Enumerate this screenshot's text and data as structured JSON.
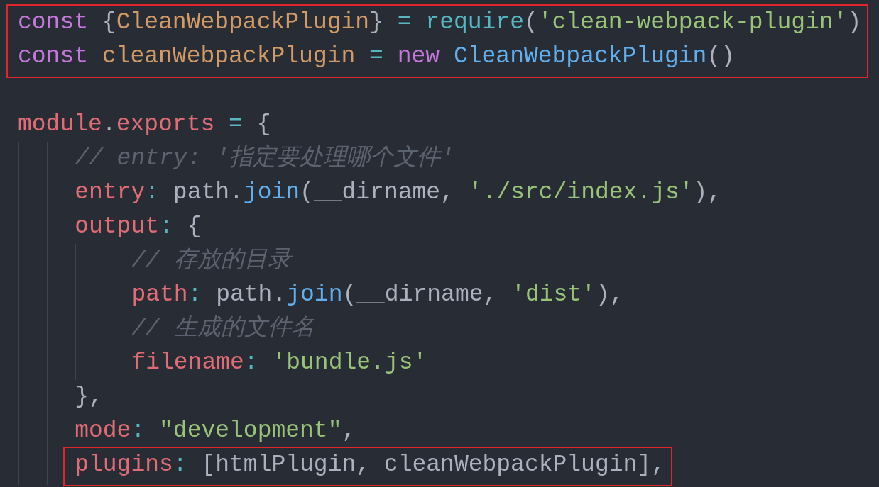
{
  "code": [
    {
      "kind": "code",
      "boxed": true,
      "tokens": [
        {
          "text": "const",
          "kind": "keyword"
        },
        {
          "text": " {",
          "kind": "punct"
        },
        {
          "text": "CleanWebpackPlugin",
          "kind": "variable"
        },
        {
          "text": "} ",
          "kind": "punct"
        },
        {
          "text": "=",
          "kind": "operator"
        },
        {
          "text": " require",
          "kind": "builtin"
        },
        {
          "text": "(",
          "kind": "punct"
        },
        {
          "text": "'clean-webpack-plugin'",
          "kind": "string"
        },
        {
          "text": ")",
          "kind": "punct"
        }
      ]
    },
    {
      "kind": "code",
      "boxed": true,
      "tokens": [
        {
          "text": "const",
          "kind": "keyword"
        },
        {
          "text": " cleanWebpackPlugin",
          "kind": "variable"
        },
        {
          "text": " =",
          "kind": "operator"
        },
        {
          "text": " new",
          "kind": "keyword"
        },
        {
          "text": " CleanWebpackPlugin",
          "kind": "function"
        },
        {
          "text": "()",
          "kind": "punct"
        }
      ]
    },
    {
      "kind": "blank",
      "boxed": false
    },
    {
      "kind": "code",
      "boxed": false,
      "tokens": [
        {
          "text": "module",
          "kind": "property"
        },
        {
          "text": ".",
          "kind": "punct"
        },
        {
          "text": "exports",
          "kind": "property"
        },
        {
          "text": " =",
          "kind": "operator"
        },
        {
          "text": " {",
          "kind": "punct"
        }
      ],
      "children": [
        {
          "kind": "code",
          "boxed": false,
          "tokens": [
            {
              "text": "// entry: '指定要处理哪个文件'",
              "kind": "comment"
            }
          ]
        },
        {
          "kind": "code",
          "boxed": false,
          "tokens": [
            {
              "text": "entry",
              "kind": "property"
            },
            {
              "text": ":",
              "kind": "operator"
            },
            {
              "text": " path.",
              "kind": "punct"
            },
            {
              "text": "join",
              "kind": "function"
            },
            {
              "text": "(__dirname, ",
              "kind": "punct"
            },
            {
              "text": "'./src/index.js'",
              "kind": "string"
            },
            {
              "text": "),",
              "kind": "punct"
            }
          ]
        },
        {
          "kind": "code",
          "boxed": false,
          "tokens": [
            {
              "text": "output",
              "kind": "property"
            },
            {
              "text": ":",
              "kind": "operator"
            },
            {
              "text": " {",
              "kind": "punct"
            }
          ],
          "children": [
            {
              "kind": "code",
              "boxed": false,
              "tokens": [
                {
                  "text": "// 存放的目录",
                  "kind": "comment"
                }
              ]
            },
            {
              "kind": "code",
              "boxed": false,
              "tokens": [
                {
                  "text": "path",
                  "kind": "property"
                },
                {
                  "text": ":",
                  "kind": "operator"
                },
                {
                  "text": " path.",
                  "kind": "punct"
                },
                {
                  "text": "join",
                  "kind": "function"
                },
                {
                  "text": "(__dirname, ",
                  "kind": "punct"
                },
                {
                  "text": "'dist'",
                  "kind": "string"
                },
                {
                  "text": "),",
                  "kind": "punct"
                }
              ]
            },
            {
              "kind": "code",
              "boxed": false,
              "tokens": [
                {
                  "text": "// 生成的文件名",
                  "kind": "comment"
                }
              ]
            },
            {
              "kind": "code",
              "boxed": false,
              "tokens": [
                {
                  "text": "filename",
                  "kind": "property"
                },
                {
                  "text": ":",
                  "kind": "operator"
                },
                {
                  "text": " 'bundle.js'",
                  "kind": "string"
                }
              ]
            }
          ]
        },
        {
          "kind": "code",
          "boxed": false,
          "tokens": [
            {
              "text": "},",
              "kind": "punct"
            }
          ]
        },
        {
          "kind": "code",
          "boxed": false,
          "tokens": [
            {
              "text": "mode",
              "kind": "property"
            },
            {
              "text": ":",
              "kind": "operator"
            },
            {
              "text": " \"development\"",
              "kind": "string"
            },
            {
              "text": ",",
              "kind": "punct"
            }
          ]
        },
        {
          "kind": "code",
          "boxed": true,
          "tokens": [
            {
              "text": "plugins",
              "kind": "property"
            },
            {
              "text": ":",
              "kind": "operator"
            },
            {
              "text": " [htmlPlugin, cleanWebpackPlugin],",
              "kind": "punct"
            }
          ]
        }
      ]
    }
  ]
}
